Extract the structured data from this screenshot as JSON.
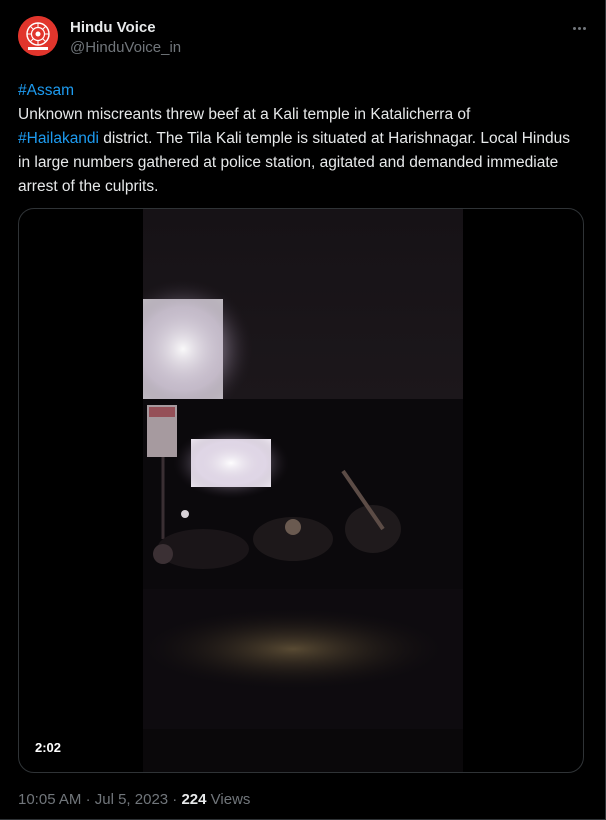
{
  "account": {
    "display_name": "Hindu Voice",
    "handle": "@HinduVoice_in",
    "avatar_icon": "hindu-voice-logo-icon",
    "avatar_color": "#e1352c"
  },
  "menu": {
    "icon": "more-options-icon"
  },
  "tweet": {
    "hashtag_1": "#Assam",
    "text_1": "Unknown miscreants threw beef at a Kali temple in Katalicherra of",
    "hashtag_2": "#Hailakandi",
    "text_2": " district. The Tila Kali temple is situated at Harishnagar. Local Hindus in large numbers gathered at police station, agitated and demanded immediate arrest of the culprits.",
    "link_color": "#1d9bf0"
  },
  "video": {
    "duration": "2:02"
  },
  "footer": {
    "time": "10:05 AM",
    "separator": "·",
    "date": "Jul 5, 2023",
    "views_count": "224",
    "views_label": "Views"
  }
}
